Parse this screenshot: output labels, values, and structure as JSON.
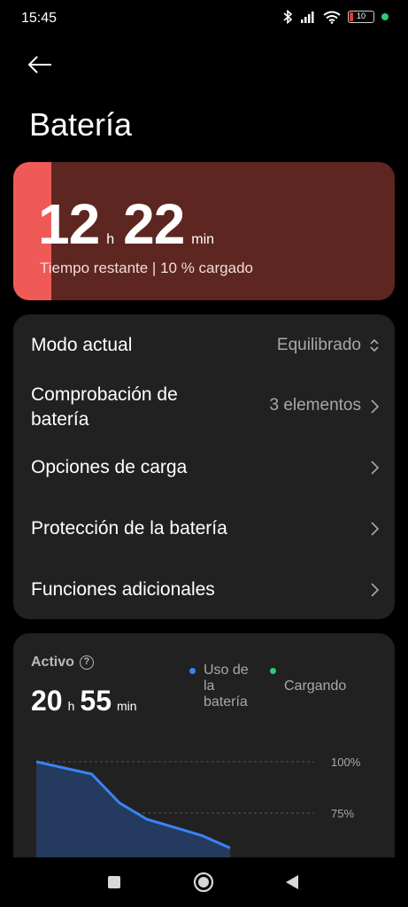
{
  "status_bar": {
    "time": "15:45",
    "battery_level": "10",
    "icons": [
      "bluetooth-icon",
      "signal-icon",
      "wifi-icon",
      "battery-icon",
      "charging-dot-icon"
    ],
    "charging_color": "#2ecc71"
  },
  "header": {
    "title": "Batería",
    "back_icon": "back-arrow-icon"
  },
  "battery_card": {
    "hours": "12",
    "hours_unit": "h",
    "minutes": "22",
    "minutes_unit": "min",
    "subtitle": "Tiempo restante | 10 % cargado",
    "level_fraction": 0.1,
    "fill_color": "#f05a56",
    "card_color": "#5e2621"
  },
  "menu": {
    "items": [
      {
        "label": "Modo actual",
        "value": "Equilibrado",
        "icon": "updown-chevron-icon"
      },
      {
        "label": "Comprobación de batería",
        "value": "3 elementos",
        "icon": "chevron-right-icon"
      },
      {
        "label": "Opciones de carga",
        "value": "",
        "icon": "chevron-right-icon"
      },
      {
        "label": "Protección de la batería",
        "value": "",
        "icon": "chevron-right-icon"
      },
      {
        "label": "Funciones adicionales",
        "value": "",
        "icon": "chevron-right-icon"
      }
    ]
  },
  "active": {
    "label": "Activo",
    "help_icon": "help-circle-icon",
    "hours": "20",
    "hours_unit": "h",
    "minutes": "55",
    "minutes_unit": "min",
    "legend": [
      {
        "label": "Uso de la batería",
        "color": "#3b82f6"
      },
      {
        "label": "Cargando",
        "color": "#2ecc71"
      }
    ]
  },
  "chart_data": {
    "type": "area",
    "series": [
      {
        "name": "Uso de la batería",
        "values": [
          100,
          97,
          94,
          80,
          72,
          68,
          64,
          58
        ]
      }
    ],
    "x": [
      0,
      1,
      2,
      3,
      4,
      5,
      6,
      7
    ],
    "y_tick_labels": [
      "100%",
      "75%"
    ],
    "ylim": [
      50,
      100
    ],
    "grid": true
  },
  "nav_bar": {
    "buttons": [
      "recent-apps-icon",
      "home-icon",
      "back-icon"
    ]
  }
}
